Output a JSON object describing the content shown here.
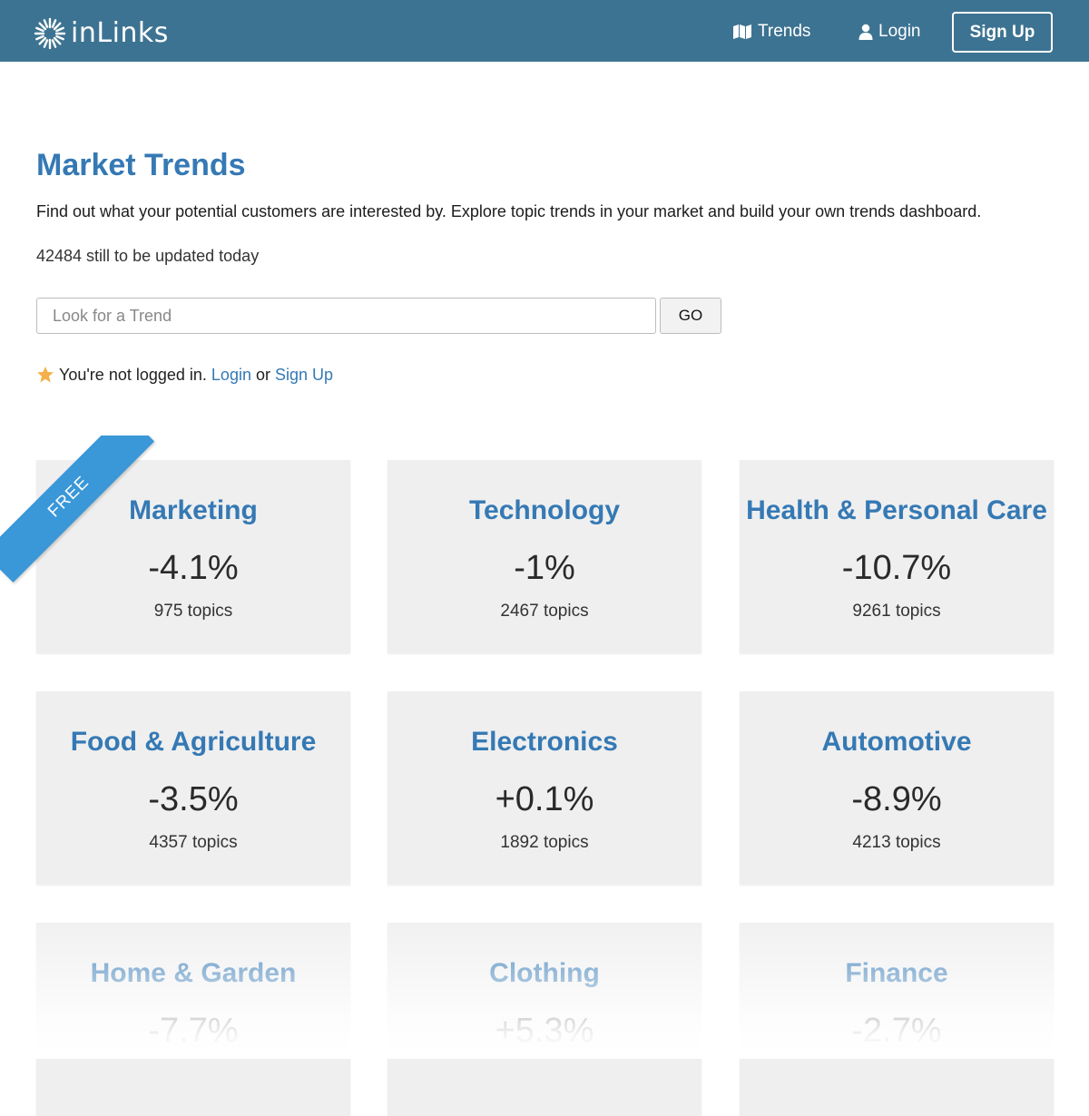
{
  "header": {
    "logo_text": "inLinks",
    "nav": {
      "trends_label": "Trends",
      "login_label": "Login",
      "signup_label": "Sign Up"
    }
  },
  "main": {
    "title": "Market Trends",
    "intro": "Find out what your potential customers are interested by. Explore topic trends in your market and build your own trends dashboard.",
    "update_status": "42484 still to be updated today",
    "search": {
      "placeholder": "Look for a Trend",
      "value": "",
      "button_label": "GO"
    },
    "login_note": {
      "text": "You're not logged in.",
      "login_link": "Login",
      "or": "or",
      "signup_link": "Sign Up"
    },
    "ribbon_label": "FREE"
  },
  "categories": [
    {
      "name": "Marketing",
      "change": "-4.1%",
      "topics": "975 topics"
    },
    {
      "name": "Technology",
      "change": "-1%",
      "topics": "2467 topics"
    },
    {
      "name": "Health & Personal Care",
      "change": "-10.7%",
      "topics": "9261 topics"
    },
    {
      "name": "Food & Agriculture",
      "change": "-3.5%",
      "topics": "4357 topics"
    },
    {
      "name": "Electronics",
      "change": "+0.1%",
      "topics": "1892 topics"
    },
    {
      "name": "Automotive",
      "change": "-8.9%",
      "topics": "4213 topics"
    },
    {
      "name": "Home & Garden",
      "change": "-7.7%",
      "topics": ""
    },
    {
      "name": "Clothing",
      "change": "+5.3%",
      "topics": ""
    },
    {
      "name": "Finance",
      "change": "-2.7%",
      "topics": ""
    }
  ],
  "icons": {
    "logo": "sunburst-logo-icon",
    "trends": "map-icon",
    "login": "user-icon",
    "note": "star-icon"
  },
  "colors": {
    "header": "#3d7392",
    "accent": "#3579b4",
    "ribbon": "#3a97d8",
    "star": "#f4b04a",
    "card": "#efefef"
  }
}
